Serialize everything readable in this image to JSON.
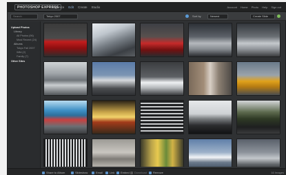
{
  "app": {
    "logo": "PHOTOSHOP EXPRESS"
  },
  "topnav": [
    "Organize",
    "Edit",
    "Create",
    "Studio"
  ],
  "toplinks": [
    "Account",
    "Home",
    "Photo",
    "Help",
    "Sign out"
  ],
  "toolbar": {
    "search_placeholder": "Search",
    "album_select": "Tokyo 2007",
    "sort_label": "Sort by",
    "sort_value": "Newest",
    "view_select": "Create Slide"
  },
  "sidebar": {
    "items": [
      {
        "label": "Upload Photos",
        "level": "head"
      },
      {
        "label": "Library",
        "level": "1"
      },
      {
        "label": "All Photos (96)",
        "level": "2"
      },
      {
        "label": "Most Recent (24)",
        "level": "2"
      },
      {
        "label": "Albums",
        "level": "1"
      },
      {
        "label": "Tokyo Fall 2007",
        "level": "2"
      },
      {
        "label": "Wild (2)",
        "level": "2"
      },
      {
        "label": "Family (7)",
        "level": "2"
      },
      {
        "label": "Other Sites",
        "level": "head"
      }
    ]
  },
  "bottombar": {
    "items": [
      "Share to Album",
      "Slideshow",
      "Email",
      "Link",
      "Embed",
      "Download",
      "Remove"
    ],
    "page_count": "16 Images"
  }
}
